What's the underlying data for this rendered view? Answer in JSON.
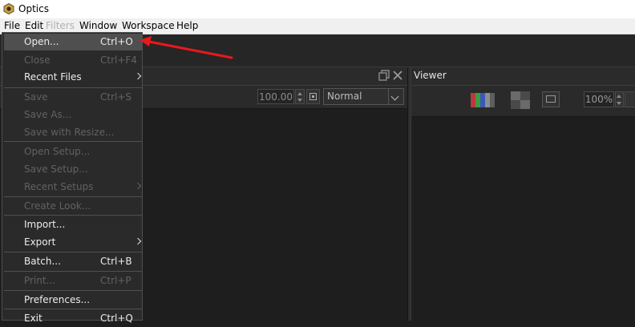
{
  "app": {
    "title": "Optics"
  },
  "menubar": {
    "file": "File",
    "edit": "Edit",
    "ghost": "Filters",
    "window": "Window",
    "workspace": "Workspace",
    "help": "Help"
  },
  "left_panel": {
    "amount_value": "100.00",
    "blend_mode": "Normal"
  },
  "viewer": {
    "title": "Viewer",
    "zoom": "100%"
  },
  "file_menu": {
    "items": [
      {
        "label": "Open...",
        "shortcut": "Ctrl+O"
      },
      {
        "label": "Close",
        "shortcut": "Ctrl+F4"
      },
      {
        "label": "Recent Files",
        "shortcut": ""
      },
      {
        "label": "Save",
        "shortcut": "Ctrl+S"
      },
      {
        "label": "Save As...",
        "shortcut": ""
      },
      {
        "label": "Save with Resize...",
        "shortcut": ""
      },
      {
        "label": "Open Setup...",
        "shortcut": ""
      },
      {
        "label": "Save Setup...",
        "shortcut": ""
      },
      {
        "label": "Recent Setups",
        "shortcut": ""
      },
      {
        "label": "Create Look...",
        "shortcut": ""
      },
      {
        "label": "Import...",
        "shortcut": ""
      },
      {
        "label": "Export",
        "shortcut": ""
      },
      {
        "label": "Batch...",
        "shortcut": "Ctrl+B"
      },
      {
        "label": "Print...",
        "shortcut": "Ctrl+P"
      },
      {
        "label": "Preferences...",
        "shortcut": ""
      },
      {
        "label": "Exit",
        "shortcut": "Ctrl+Q"
      }
    ]
  },
  "colors": {
    "annotation_arrow": "#e8191c",
    "menu_highlight": "#4f4f4f"
  }
}
